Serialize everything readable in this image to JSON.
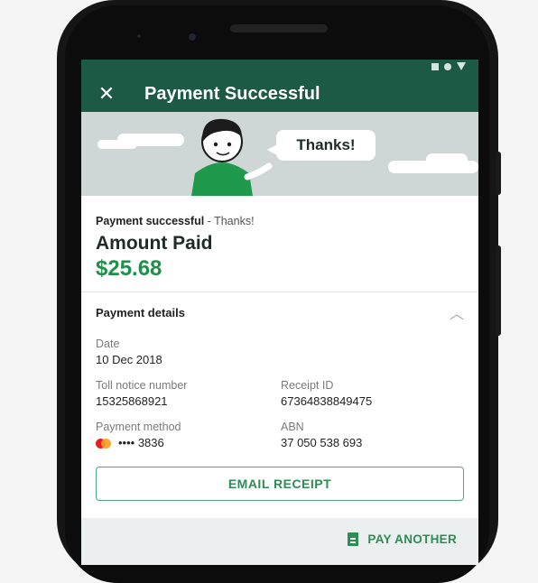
{
  "header": {
    "title": "Payment Successful"
  },
  "banner": {
    "speech": "Thanks!"
  },
  "status": {
    "bold": "Payment successful",
    "rest": " - Thanks!"
  },
  "amount": {
    "label": "Amount Paid",
    "value": "$25.68"
  },
  "details": {
    "title": "Payment details",
    "date": {
      "label": "Date",
      "value": "10 Dec 2018"
    },
    "toll_notice": {
      "label": "Toll notice number",
      "value": "15325868921"
    },
    "receipt_id": {
      "label": "Receipt ID",
      "value": "67364838849475"
    },
    "payment_method": {
      "label": "Payment method",
      "value": "•••• 3836"
    },
    "abn": {
      "label": "ABN",
      "value": "37 050 538 693"
    }
  },
  "actions": {
    "email_receipt": "EMAIL RECEIPT",
    "pay_another": "PAY ANOTHER"
  },
  "colors": {
    "brand": "#1c5a46",
    "accent": "#1f8f4a"
  },
  "icons": {
    "close": "close-icon",
    "chevron": "chevron-up-icon",
    "doc": "document-icon",
    "card": "mastercard-icon"
  }
}
